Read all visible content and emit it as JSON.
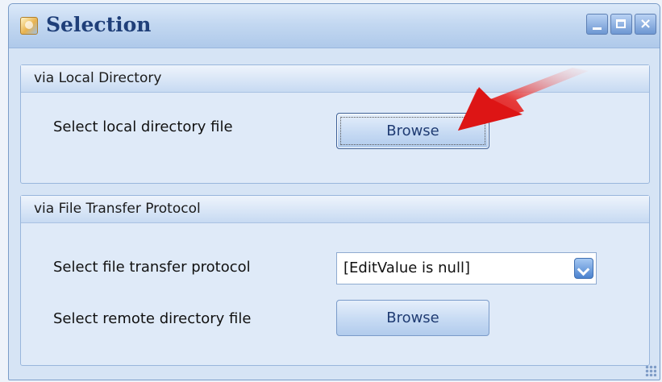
{
  "window": {
    "title": "Selection",
    "controls": [
      "minimize-icon",
      "maximize-icon",
      "close-icon"
    ]
  },
  "local_group": {
    "header": "via Local Directory",
    "label": "Select local directory file",
    "browse_label": "Browse"
  },
  "ftp_group": {
    "header": "via File Transfer Protocol",
    "protocol_label": "Select file transfer protocol",
    "protocol_value": "[EditValue is null]",
    "remote_label": "Select remote directory file",
    "browse_label": "Browse"
  },
  "colors": {
    "accent": "#1f3f79",
    "arrow": "#e01b1b"
  }
}
